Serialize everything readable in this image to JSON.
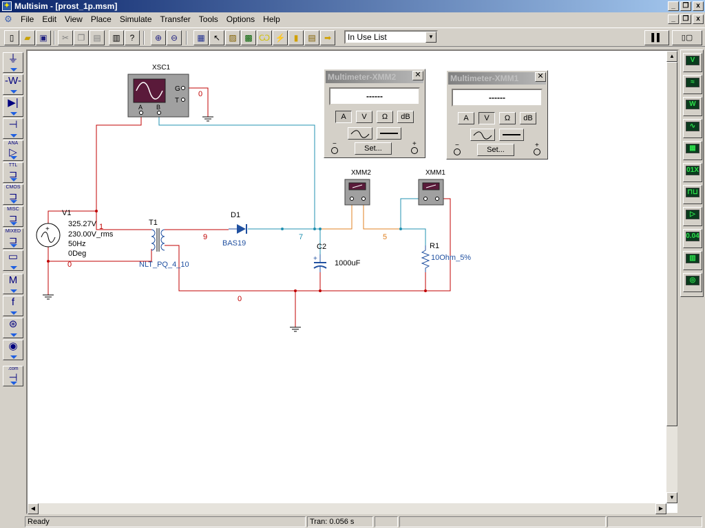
{
  "window": {
    "title": "Multisim - [prost_1p.msm]",
    "minimize_glyph": "_",
    "restore_glyph": "❐",
    "close_glyph": "x"
  },
  "menu": [
    "File",
    "Edit",
    "View",
    "Place",
    "Simulate",
    "Transfer",
    "Tools",
    "Options",
    "Help"
  ],
  "toolbar": {
    "in_use_list": "In Use List"
  },
  "left_toolbar": [
    {
      "name": "sources",
      "glyph": "⏚",
      "tag": ""
    },
    {
      "name": "basic",
      "glyph": "-W-",
      "tag": ""
    },
    {
      "name": "diodes",
      "glyph": "▶|",
      "tag": ""
    },
    {
      "name": "transistors",
      "glyph": "⊣",
      "tag": ""
    },
    {
      "name": "analog",
      "glyph": "▷",
      "tag": "ANA"
    },
    {
      "name": "ttl",
      "glyph": "⊐",
      "tag": "TTL"
    },
    {
      "name": "cmos",
      "glyph": "⊐",
      "tag": "CMOS"
    },
    {
      "name": "misc-digital",
      "glyph": "⊐",
      "tag": "MISC"
    },
    {
      "name": "mixed",
      "glyph": "⊐",
      "tag": "MIXED"
    },
    {
      "name": "indicators",
      "glyph": "▭",
      "tag": ""
    },
    {
      "name": "misc",
      "glyph": "M",
      "tag": ""
    },
    {
      "name": "controls",
      "glyph": "f",
      "tag": ""
    },
    {
      "name": "rf",
      "glyph": "⊛",
      "tag": ""
    },
    {
      "name": "electromechanical",
      "glyph": "◉",
      "tag": ""
    },
    {
      "name": "com",
      "glyph": "⊣",
      "tag": ".com"
    }
  ],
  "right_toolbar": [
    {
      "name": "multimeter",
      "label": "V"
    },
    {
      "name": "function-generator",
      "label": "≈"
    },
    {
      "name": "wattmeter",
      "label": "W"
    },
    {
      "name": "oscilloscope",
      "label": "∿"
    },
    {
      "name": "bode-plotter",
      "label": "▦"
    },
    {
      "name": "word-generator",
      "label": "01X"
    },
    {
      "name": "logic-analyzer",
      "label": "⊓⊔"
    },
    {
      "name": "logic-converter",
      "label": "▷"
    },
    {
      "name": "distortion-analyzer",
      "label": "0.04"
    },
    {
      "name": "spectrum-analyzer",
      "label": "▥"
    },
    {
      "name": "network-analyzer",
      "label": "◎"
    }
  ],
  "schematic": {
    "xsc1": {
      "ref": "XSC1",
      "pin_a": "A",
      "pin_b": "B",
      "pin_g": "G",
      "pin_t": "T"
    },
    "v1": {
      "ref": "V1",
      "peak": "325.27V",
      "rms": "230.00V_rms",
      "freq": "50Hz",
      "phase": "0Deg"
    },
    "t1": {
      "ref": "T1",
      "model": "NLT_PQ_4_10"
    },
    "d1": {
      "ref": "D1",
      "model": "BAS19"
    },
    "c2": {
      "ref": "C2",
      "value": "1000uF"
    },
    "r1": {
      "ref": "R1",
      "value": "10Ohm_5%"
    },
    "xmm1": {
      "ref": "XMM1"
    },
    "xmm2": {
      "ref": "XMM2"
    },
    "nodes": {
      "n0_g": "0",
      "n1": "1",
      "n0_v": "0",
      "n9": "9",
      "n7": "7",
      "n5": "5",
      "n0_bottom": "0"
    }
  },
  "multimeters": [
    {
      "id": "xmm2",
      "title": "Multimeter-XMM2",
      "reading": "------",
      "buttons": [
        "A",
        "V",
        "Ω",
        "dB"
      ],
      "active": "A",
      "set_label": "Set...",
      "minus": "−",
      "plus": "+"
    },
    {
      "id": "xmm1",
      "title": "Multimeter-XMM1",
      "reading": "------",
      "buttons": [
        "A",
        "V",
        "Ω",
        "dB"
      ],
      "active": "V",
      "set_label": "Set...",
      "minus": "−",
      "plus": "+"
    }
  ],
  "status": {
    "left": "Ready",
    "tran": "Tran: 0.056 s"
  },
  "colors": {
    "wire_red": "#c00000",
    "wire_teal": "#2090b0",
    "wire_orange": "#e08020",
    "instrument_screen": "#5a1a3a"
  }
}
